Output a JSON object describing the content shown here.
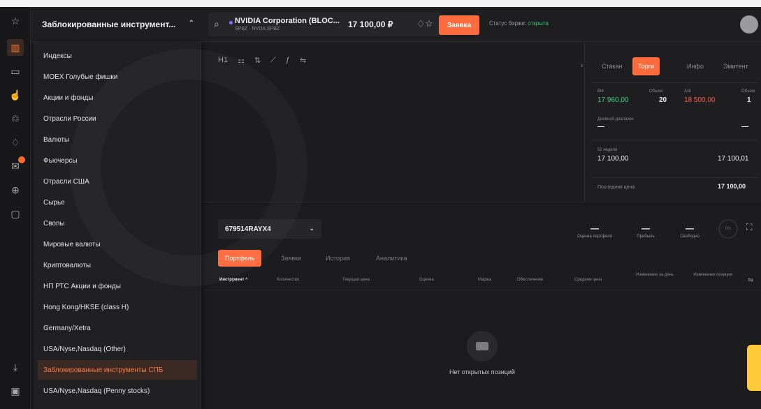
{
  "header": {
    "group_label": "Заблокированные инструмент...",
    "instrument_name": "NVIDIA Corporation (BLOC...",
    "instrument_ticker": "SPBZ · NVDA.SPBZ",
    "instrument_price": "17 100,00 ₽",
    "order_button": "Заявка",
    "exchange_status_label": "Статус биржи:",
    "exchange_status_value": "открыта"
  },
  "rail": {
    "icons": [
      "star-icon",
      "chart-icon",
      "wallet-icon",
      "thumbs-up-icon",
      "recycle-icon",
      "bell-icon",
      "mail-icon",
      "globe-icon",
      "chat-icon",
      "download-icon",
      "video-icon"
    ]
  },
  "dropdown": {
    "items": [
      "Индексы",
      "MOEX Голубые фишки",
      "Акции и фонды",
      "Отрасли России",
      "Валюты",
      "Фьючерсы",
      "Отрасли США",
      "Сырье",
      "Свопы",
      "Мировые валюты",
      "Криптовалюты",
      "НП РТС Акции и фонды",
      "Hong Kong/HKSE (class H)",
      "Germany/Xetra",
      "USA/Nyse,Nasdaq (Other)",
      "Заблокированные инструменты СПБ",
      "USA/Nyse,Nasdaq (Penny stocks)"
    ],
    "selected_index": 15
  },
  "chart_toolbar": {
    "interval": "H1"
  },
  "right_panel": {
    "tabs": [
      "Стакан",
      "Торги",
      "Инфо",
      "Эмитент"
    ],
    "active_tab": "Торги",
    "bid_label": "Bid",
    "bid_value": "17 960,00",
    "bid_volume_label": "Объем",
    "bid_volume": "20",
    "ask_label": "Ask",
    "ask_value": "18 500,00",
    "ask_volume_label": "Объем",
    "ask_volume": "1",
    "daily_range_label": "Дневной диапазон",
    "daily_range_low": "—",
    "daily_range_high": "—",
    "weeks52_label": "52 недели",
    "weeks52_low": "17 100,00",
    "weeks52_high": "17 100,01",
    "last_price_label": "Последняя цена",
    "last_price": "17 100,00"
  },
  "portfolio": {
    "account": "679514RAYX4",
    "metrics": [
      {
        "value": "—",
        "label": "Оценка портфеля"
      },
      {
        "value": "—",
        "label": "Прибыль"
      },
      {
        "value": "—",
        "label": "Свободно"
      }
    ],
    "circle_label": "0%",
    "tabs": [
      "Портфель",
      "Заявки",
      "История",
      "Аналитика"
    ],
    "active_tab": "Портфель",
    "columns": [
      "Инструмент ^",
      "Количество",
      "Текущая цена",
      "Оценка",
      "Маржа",
      "Обеспечение",
      "Средняя цена",
      "Изменение за день",
      "Изменение позиции"
    ],
    "empty_text": "Нет открытых позиций"
  },
  "colors": {
    "accent": "#ff6b3d",
    "bid": "#3ed27a",
    "ask": "#ff5a4a",
    "status_open": "#38c872"
  }
}
